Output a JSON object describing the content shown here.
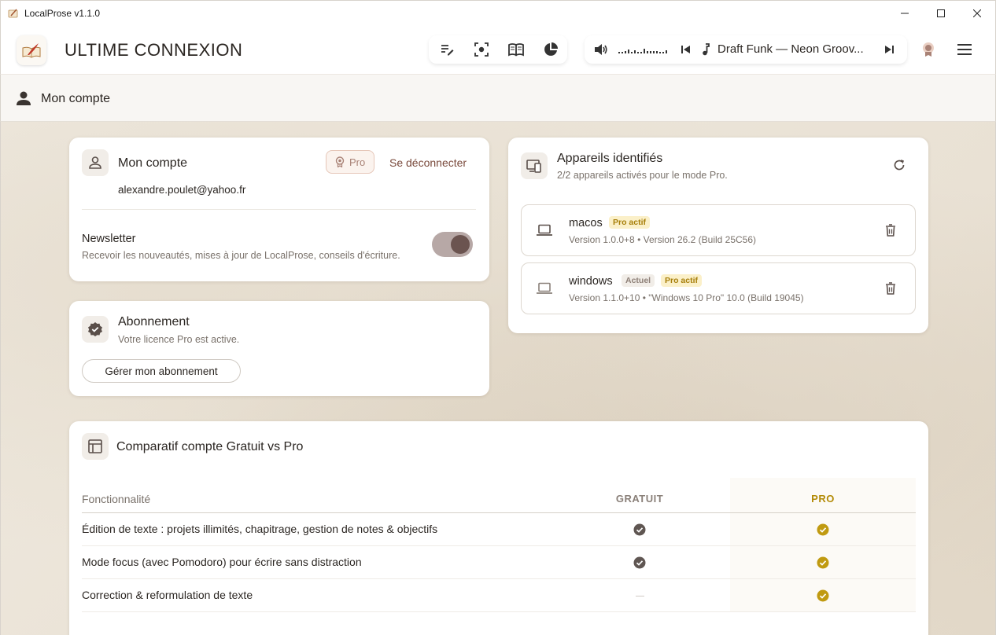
{
  "window": {
    "title": "LocalProse v1.1.0"
  },
  "header": {
    "app_title": "ULTIME CONNEXION",
    "player": {
      "track": "Draft Funk — Neon Groov..."
    }
  },
  "page": {
    "title": "Mon compte"
  },
  "account": {
    "title": "Mon compte",
    "email": "alexandre.poulet@yahoo.fr",
    "badge": "Pro",
    "logout_label": "Se déconnecter",
    "newsletter": {
      "label": "Newsletter",
      "description": "Recevoir les nouveautés, mises à jour de LocalProse, conseils d'écriture.",
      "enabled": true
    }
  },
  "subscription": {
    "title": "Abonnement",
    "status": "Votre licence Pro est active.",
    "manage_label": "Gérer mon abonnement"
  },
  "devices": {
    "title": "Appareils identifiés",
    "subtitle": "2/2 appareils activés pour le mode Pro.",
    "items": [
      {
        "name": "macos",
        "tags": [
          "Pro actif"
        ],
        "version": "Version 1.0.0+8 • Version 26.2 (Build 25C56)"
      },
      {
        "name": "windows",
        "tags": [
          "Actuel",
          "Pro actif"
        ],
        "version": "Version 1.1.0+10 • \"Windows 10 Pro\" 10.0 (Build 19045)"
      }
    ]
  },
  "comparison": {
    "title": "Comparatif compte Gratuit vs Pro",
    "columns": [
      "Fonctionnalité",
      "GRATUIT",
      "PRO"
    ],
    "rows": [
      {
        "feature": "Édition de texte : projets illimités, chapitrage, gestion de notes & objectifs",
        "free": true,
        "pro": true
      },
      {
        "feature": "Mode focus (avec Pomodoro) pour écrire sans distraction",
        "free": true,
        "pro": true
      },
      {
        "feature": "Correction & reformulation de texte",
        "free": false,
        "pro": true
      }
    ]
  },
  "colors": {
    "accent_pro": "#b38b07",
    "accent_brown": "#7a4a3c",
    "toggle_on": "#6b5450"
  }
}
